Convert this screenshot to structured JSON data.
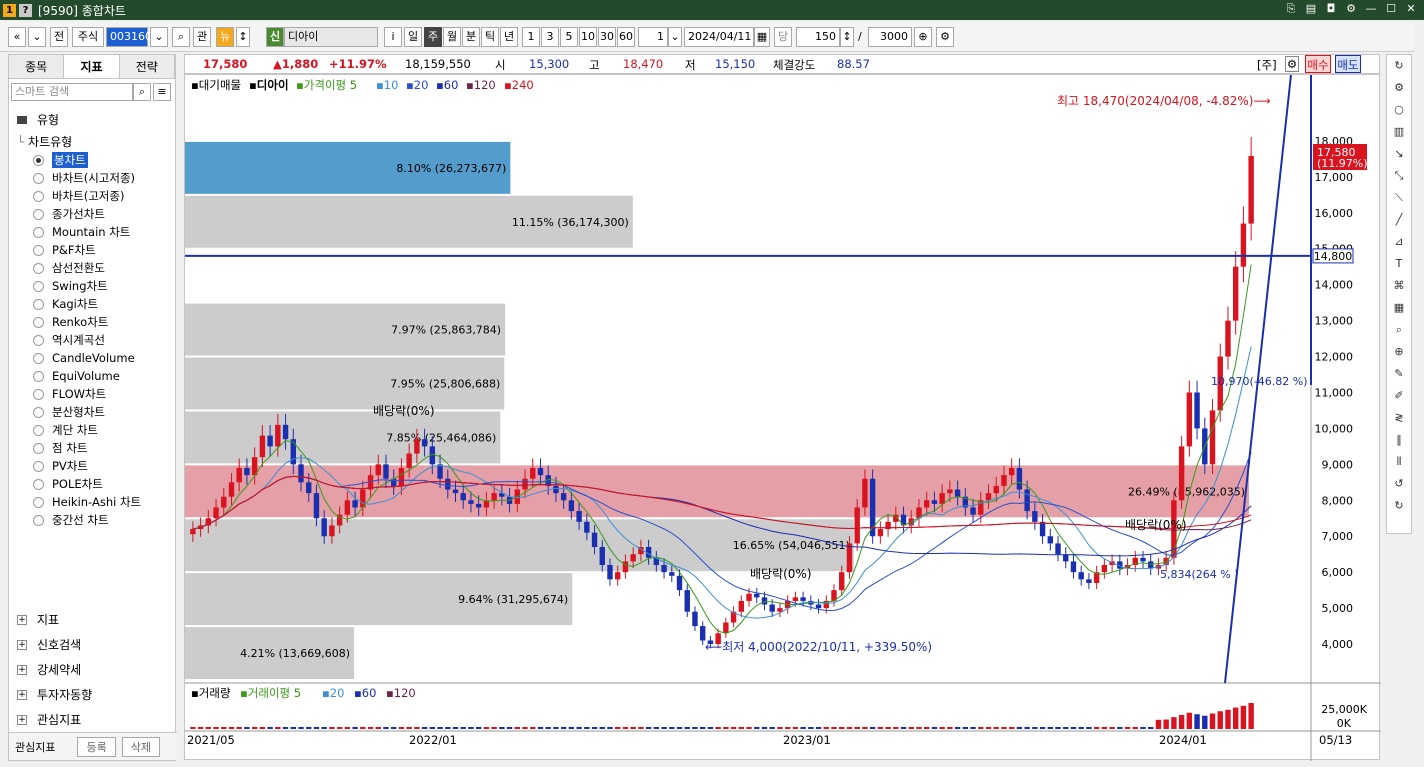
{
  "window": {
    "code": "[9590]",
    "title": "종합차트"
  },
  "toolbar": {
    "nav_prev": "«",
    "nav_down": "»",
    "btn_jeon": "전",
    "market": "주식",
    "code": "003160",
    "btn_gwan": "관",
    "btn_nyu": "뉴",
    "badge_sin": "신",
    "stock_name": "디아이",
    "btn_info": "i",
    "periods": [
      "일",
      "주",
      "월",
      "분",
      "틱",
      "년"
    ],
    "active_period": "주",
    "nums": [
      "1",
      "3",
      "5",
      "10",
      "30",
      "60"
    ],
    "sel_num": "1",
    "date": "2024/04/11",
    "count_label": "당",
    "count": "150",
    "total": "3000"
  },
  "left_panel": {
    "tabs": [
      "종목",
      "지표",
      "전략"
    ],
    "search_placeholder": "스마트 검색",
    "section_type": "유형",
    "section_chart_type": "차트유형",
    "chart_types": [
      "봉차트",
      "바차트(시고저종)",
      "바차트(고저종)",
      "종가선차트",
      "Mountain 차트",
      "P&F차트",
      "삼선전환도",
      "Swing차트",
      "Kagi차트",
      "Renko차트",
      "역시계곡선",
      "CandleVolume",
      "EquiVolume",
      "FLOW차트",
      "분산형차트",
      "계단 차트",
      "점 차트",
      "PV차트",
      "POLE차트",
      "Heikin-Ashi 차트",
      "중간선 차트"
    ],
    "tree_items": [
      "지표",
      "신호검색",
      "강세약세",
      "투자자동향",
      "관심지표"
    ],
    "bottom_label": "관심지표",
    "bottom_btn1": "등록",
    "bottom_btn2": "삭제"
  },
  "quote": {
    "price": "17,580",
    "change": "▲1,880",
    "pct": "+11.97%",
    "volume": "18,159,550",
    "open_label": "시",
    "open": "15,300",
    "high_label": "고",
    "high": "18,470",
    "low_label": "저",
    "low": "15,150",
    "strength_label": "체결강도",
    "strength": "88.57",
    "tag_ju": "[주]",
    "buy": "매수",
    "sell": "매도"
  },
  "chart_data": {
    "type": "candlestick",
    "legend_top": [
      "대기매물",
      "디아이",
      "가격이평 5",
      "10",
      "20",
      "60",
      "120",
      "240"
    ],
    "legend_bottom": [
      "거래량",
      "거래이평 5",
      "20",
      "60",
      "120"
    ],
    "y_ticks": [
      18000,
      17000,
      16000,
      15000,
      14000,
      13000,
      12000,
      11000,
      10000,
      9000,
      8000,
      7000,
      6000,
      5000,
      4000
    ],
    "y_range": [
      3000,
      19500
    ],
    "x_labels": [
      "2021/05",
      "2022/01",
      "2023/01",
      "2024/01",
      "05/13"
    ],
    "vol_ticks": [
      "25,000K",
      "0K"
    ],
    "current_price": "17,580",
    "current_pct": "(11.97%)",
    "hline_price": "14,800",
    "annotations": {
      "high": "최고 18,470(2024/04/08, -4.82%)",
      "low": "최저 4,000(2022/10/11, +339.50%)",
      "div1": "배당락(0%)",
      "div2": "배당락(0%)",
      "div3": "배당락(0%)",
      "lbl_10": "10,970(-46.82 %)",
      "lbl_5": "5,834(264 % )"
    },
    "volume_profile": [
      {
        "label": "8.10% (26,273,677)",
        "value": 8.1,
        "lo": 16500,
        "hi": 18000
      },
      {
        "label": "11.15% (36,174,300)",
        "value": 11.15,
        "lo": 15000,
        "hi": 16500
      },
      {
        "label": "7.97% (25,863,784)",
        "value": 7.97,
        "lo": 12000,
        "hi": 13500
      },
      {
        "label": "7.95% (25,806,688)",
        "value": 7.95,
        "lo": 10500,
        "hi": 12000
      },
      {
        "label": "7.85% (25,464,086)",
        "value": 7.85,
        "lo": 9000,
        "hi": 10500
      },
      {
        "label": "26.49% (85,962,035)",
        "value": 26.49,
        "lo": 7500,
        "hi": 9000
      },
      {
        "label": "16.65% (54,046,551)",
        "value": 16.65,
        "lo": 6000,
        "hi": 7500
      },
      {
        "label": "9.64% (31,295,674)",
        "value": 9.64,
        "lo": 4500,
        "hi": 6000
      },
      {
        "label": "4.21% (13,669,608)",
        "value": 4.21,
        "lo": 3000,
        "hi": 4500
      }
    ],
    "series": [
      {
        "name": "디아이",
        "closes": [
          7200,
          7300,
          7500,
          7800,
          8100,
          8500,
          8900,
          8700,
          9200,
          9800,
          9500,
          10100,
          9700,
          9000,
          8500,
          8200,
          7500,
          7000,
          7300,
          7600,
          8000,
          7800,
          8300,
          8700,
          9000,
          8600,
          8400,
          8900,
          9300,
          9700,
          9500,
          9000,
          8600,
          8300,
          8200,
          8000,
          7900,
          7800,
          8000,
          8200,
          8100,
          7900,
          8300,
          8600,
          8900,
          8700,
          8400,
          8200,
          8000,
          7700,
          7400,
          7100,
          6700,
          6200,
          5800,
          6000,
          6300,
          6500,
          6700,
          6400,
          6200,
          6000,
          5900,
          5500,
          4900,
          4500,
          4100,
          4000,
          4300,
          4600,
          4900,
          5200,
          5400,
          5300,
          5100,
          4900,
          5000,
          5200,
          5300,
          5200,
          5100,
          5000,
          5200,
          5500,
          6000,
          6800,
          7800,
          8600,
          7000,
          7200,
          7400,
          7600,
          7300,
          7500,
          7800,
          8000,
          7900,
          8200,
          8300,
          8100,
          7800,
          7600,
          8000,
          8200,
          8400,
          8700,
          8900,
          8300,
          7700,
          7400,
          7000,
          6800,
          6500,
          6300,
          6000,
          5800,
          5700,
          6000,
          6200,
          6300,
          6100,
          6200,
          6400,
          6300,
          6100,
          6200,
          6400,
          8000,
          9500,
          11000,
          10000,
          9000,
          10500,
          12000,
          13000,
          14500,
          15700,
          17580
        ]
      }
    ]
  }
}
